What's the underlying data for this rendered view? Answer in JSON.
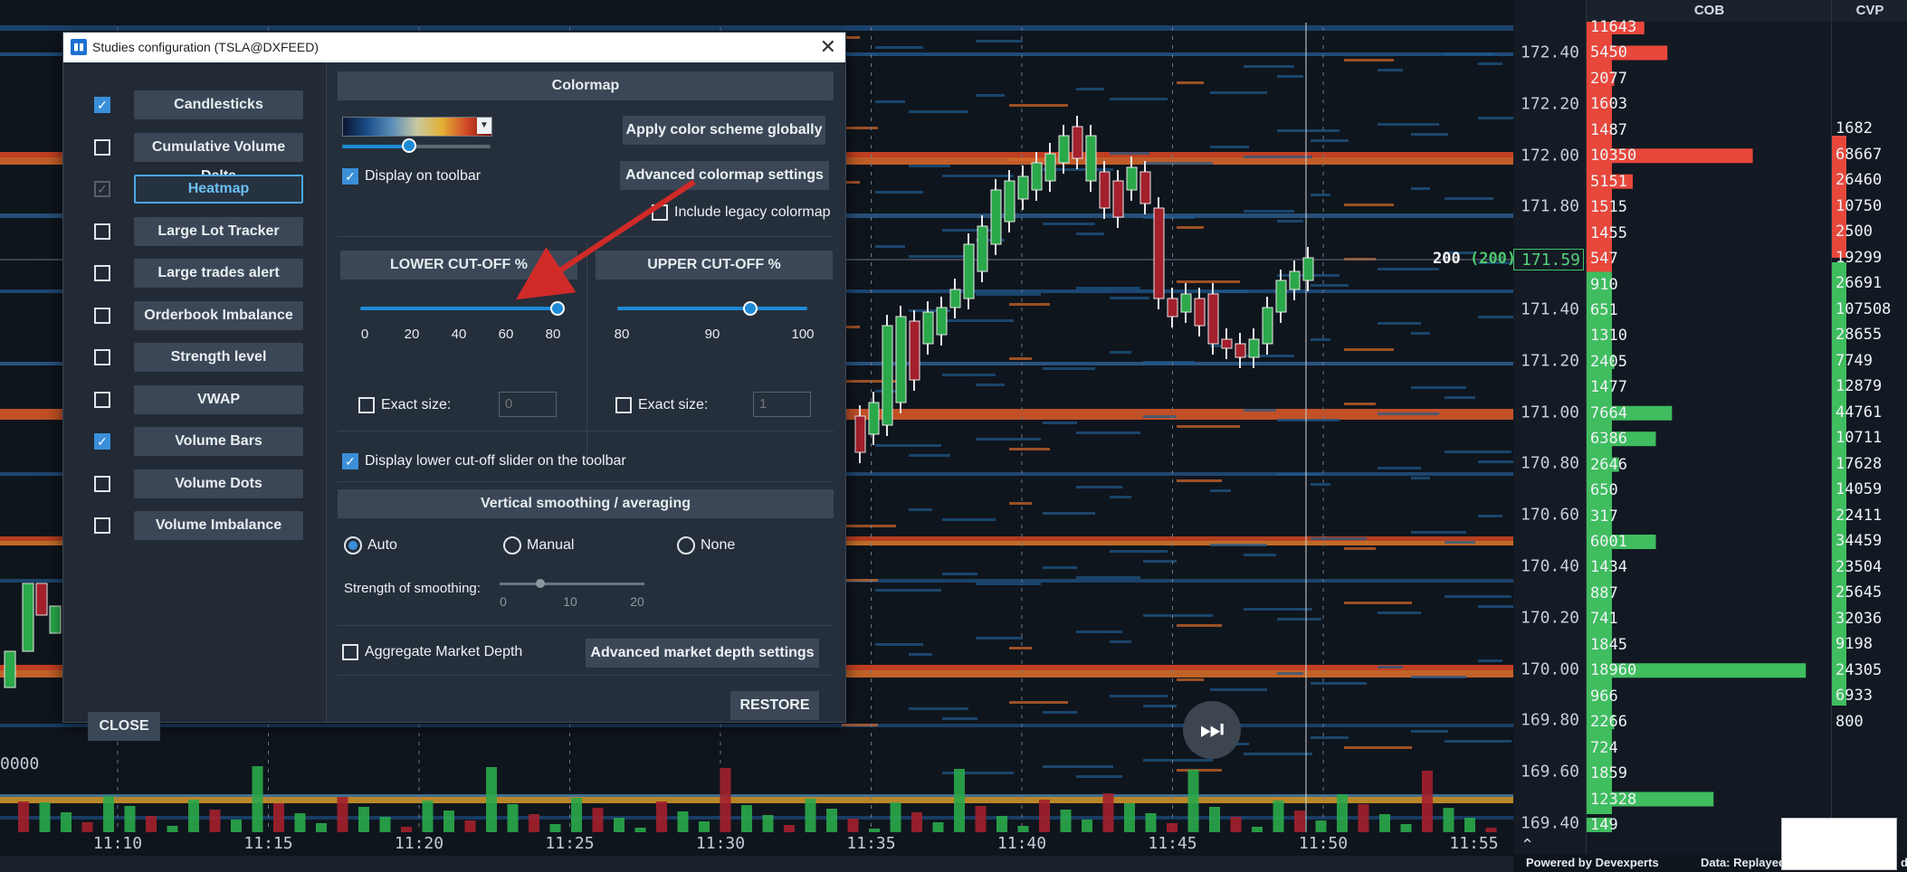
{
  "chart": {
    "time_labels": [
      "11:10",
      "11:15",
      "11:20",
      "11:25",
      "11:30",
      "11:35",
      "11:40",
      "11:45",
      "11:50",
      "11:55"
    ],
    "price_labels": [
      "172.40",
      "172.20",
      "172.00",
      "171.80",
      "171.60",
      "171.40",
      "171.20",
      "171.00",
      "170.80",
      "170.60",
      "170.40",
      "170.20",
      "170.00",
      "169.80",
      "169.60",
      "169.40"
    ],
    "current_price": "171.59",
    "current_size": "200",
    "current_size_bracket": "(200)",
    "left_value": "0000",
    "colors": {
      "bid": "#3fbd5f",
      "ask": "#e8473b",
      "up_candle": "#2aa84a",
      "down_candle": "#a3202c"
    }
  },
  "cob": {
    "header": "COB",
    "levels": [
      {
        "size": "11643",
        "side": "ask",
        "bar": 0.25
      },
      {
        "size": "5450",
        "side": "ask",
        "bar": 0.35
      },
      {
        "size": "2077",
        "side": "ask",
        "bar": 0.12
      },
      {
        "size": "1603",
        "side": "ask",
        "bar": 0.1
      },
      {
        "size": "1487",
        "side": "ask",
        "bar": 0.1
      },
      {
        "size": "10350",
        "side": "ask",
        "bar": 0.72
      },
      {
        "size": "5151",
        "side": "ask",
        "bar": 0.2
      },
      {
        "size": "1515",
        "side": "ask",
        "bar": 0.1
      },
      {
        "size": "1455",
        "side": "ask",
        "bar": 0.1
      },
      {
        "size": "547",
        "side": "ask",
        "bar": 0.05
      },
      {
        "size": "910",
        "side": "bid",
        "bar": 0.06
      },
      {
        "size": "651",
        "side": "bid",
        "bar": 0.05
      },
      {
        "size": "1310",
        "side": "bid",
        "bar": 0.08
      },
      {
        "size": "2405",
        "side": "bid",
        "bar": 0.12
      },
      {
        "size": "1477",
        "side": "bid",
        "bar": 0.1
      },
      {
        "size": "7664",
        "side": "bid",
        "bar": 0.37
      },
      {
        "size": "6386",
        "side": "bid",
        "bar": 0.3
      },
      {
        "size": "2646",
        "side": "bid",
        "bar": 0.14
      },
      {
        "size": "650",
        "side": "bid",
        "bar": 0.05
      },
      {
        "size": "317",
        "side": "bid",
        "bar": 0.04
      },
      {
        "size": "6001",
        "side": "bid",
        "bar": 0.3
      },
      {
        "size": "1434",
        "side": "bid",
        "bar": 0.1
      },
      {
        "size": "887",
        "side": "bid",
        "bar": 0.06
      },
      {
        "size": "741",
        "side": "bid",
        "bar": 0.05
      },
      {
        "size": "1845",
        "side": "bid",
        "bar": 0.1
      },
      {
        "size": "18960",
        "side": "bid",
        "bar": 0.95
      },
      {
        "size": "966",
        "side": "bid",
        "bar": 0.06
      },
      {
        "size": "2266",
        "side": "bid",
        "bar": 0.12
      },
      {
        "size": "724",
        "side": "bid",
        "bar": 0.05
      },
      {
        "size": "1859",
        "side": "bid",
        "bar": 0.1
      },
      {
        "size": "12328",
        "side": "bid",
        "bar": 0.55
      },
      {
        "size": "149",
        "side": "bid",
        "bar": 0.03
      }
    ]
  },
  "cvp": {
    "header": "CVP",
    "levels": [
      {
        "size": "1682",
        "side": "ask"
      },
      {
        "size": "68667",
        "side": "ask"
      },
      {
        "size": "26460",
        "side": "ask"
      },
      {
        "size": "10750",
        "side": "ask"
      },
      {
        "size": "2500",
        "side": "ask"
      },
      {
        "size": "19299",
        "side": "ask"
      },
      {
        "size": "26691",
        "side": "bid"
      },
      {
        "size": "107508",
        "side": "bid"
      },
      {
        "size": "28655",
        "side": "bid"
      },
      {
        "size": "7749",
        "side": "bid"
      },
      {
        "size": "12879",
        "side": "bid"
      },
      {
        "size": "44761",
        "side": "bid"
      },
      {
        "size": "10711",
        "side": "bid"
      },
      {
        "size": "17628",
        "side": "bid"
      },
      {
        "size": "14059",
        "side": "bid"
      },
      {
        "size": "22411",
        "side": "bid"
      },
      {
        "size": "34459",
        "side": "bid"
      },
      {
        "size": "23504",
        "side": "bid"
      },
      {
        "size": "25645",
        "side": "bid"
      },
      {
        "size": "32036",
        "side": "bid"
      },
      {
        "size": "9198",
        "side": "bid"
      },
      {
        "size": "24305",
        "side": "bid"
      },
      {
        "size": "6933",
        "side": "bid"
      },
      {
        "size": "800",
        "side": "bid"
      }
    ]
  },
  "footer": {
    "powered_by": "Powered by Devexperts",
    "data_status": "Data: Replayed",
    "corner": "d"
  },
  "dialog": {
    "title": "Studies configuration (TSLA@DXFEED)",
    "close_label": "CLOSE",
    "studies": [
      {
        "label": "Candlesticks",
        "checked": true,
        "active": false,
        "disabled": false
      },
      {
        "label": "Cumulative Volume Delta",
        "checked": false,
        "active": false,
        "disabled": false
      },
      {
        "label": "Heatmap",
        "checked": true,
        "active": true,
        "disabled": true
      },
      {
        "label": "Large Lot Tracker",
        "checked": false,
        "active": false,
        "disabled": false
      },
      {
        "label": "Large trades alert",
        "checked": false,
        "active": false,
        "disabled": false
      },
      {
        "label": "Orderbook Imbalance",
        "checked": false,
        "active": false,
        "disabled": false
      },
      {
        "label": "Strength level",
        "checked": false,
        "active": false,
        "disabled": false
      },
      {
        "label": "VWAP",
        "checked": false,
        "active": false,
        "disabled": false
      },
      {
        "label": "Volume Bars",
        "checked": true,
        "active": false,
        "disabled": false
      },
      {
        "label": "Volume Dots",
        "checked": false,
        "active": false,
        "disabled": false
      },
      {
        "label": "Volume Imbalance",
        "checked": false,
        "active": false,
        "disabled": false
      }
    ],
    "colormap": {
      "header": "Colormap",
      "apply_globally": "Apply color scheme globally",
      "advanced_settings": "Advanced colormap settings",
      "display_on_toolbar": "Display on toolbar",
      "include_legacy": "Include legacy colormap",
      "slider_value": 0.45
    },
    "lower_cutoff": {
      "header": "LOWER CUT-OFF %",
      "ticks": [
        "0",
        "20",
        "40",
        "60",
        "80"
      ],
      "value": 80,
      "min": 0,
      "max": 80,
      "exact_size_label": "Exact size:",
      "exact_size_placeholder": "0"
    },
    "upper_cutoff": {
      "header": "UPPER CUT-OFF %",
      "ticks": [
        "80",
        "90",
        "100"
      ],
      "value": 94,
      "min": 80,
      "max": 100,
      "exact_size_label": "Exact size:",
      "exact_size_placeholder": "1"
    },
    "display_lower_slider": "Display lower cut-off slider on the toolbar",
    "smoothing": {
      "header": "Vertical smoothing / averaging",
      "options": [
        "Auto",
        "Manual",
        "None"
      ],
      "selected": "Auto",
      "strength_label": "Strength of smoothing:",
      "ticks": [
        "0",
        "10",
        "20"
      ]
    },
    "aggregate_label": "Aggregate Market Depth",
    "advanced_depth": "Advanced market depth settings",
    "restore_label": "RESTORE"
  }
}
